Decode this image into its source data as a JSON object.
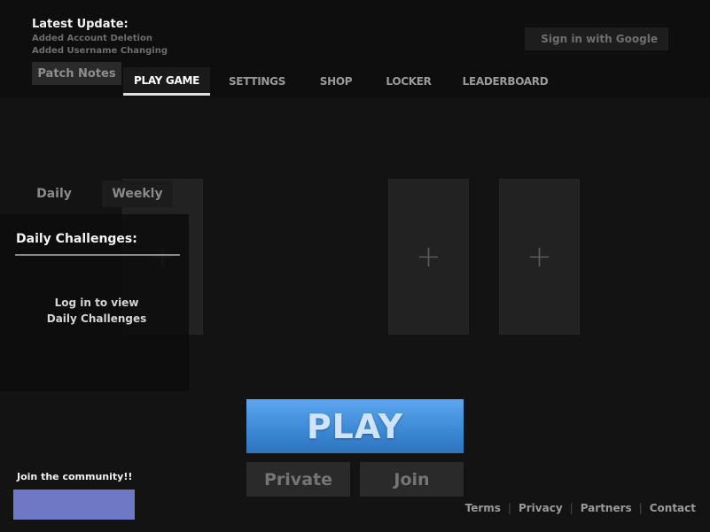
{
  "update": {
    "title": "Latest Update:",
    "lines": [
      "Added Account Deletion",
      "Added Username Changing"
    ],
    "patch_notes_label": "Patch Notes"
  },
  "auth": {
    "google_label": "Sign in with Google"
  },
  "nav": {
    "tabs": [
      {
        "label": "PLAY GAME",
        "active": true
      },
      {
        "label": "SETTINGS",
        "active": false
      },
      {
        "label": "SHOP",
        "active": false
      },
      {
        "label": "LOCKER",
        "active": false
      },
      {
        "label": "LEADERBOARD",
        "active": false
      }
    ]
  },
  "loadout": {
    "slot_icon": "+",
    "slots": 3
  },
  "challenges": {
    "tabs": [
      "Daily",
      "Weekly"
    ],
    "title": "Daily Challenges:",
    "message_line1": "Log in to view",
    "message_line2": "Daily Challenges"
  },
  "actions": {
    "play": "PLAY",
    "private": "Private",
    "join": "Join"
  },
  "community": {
    "label": "Join the community!!",
    "button_color": "#6f78c4"
  },
  "footer": {
    "links": [
      "Terms",
      "Privacy",
      "Partners",
      "Contact"
    ]
  },
  "colors": {
    "accent_play": "#3d8ad6",
    "background": "#131313"
  }
}
